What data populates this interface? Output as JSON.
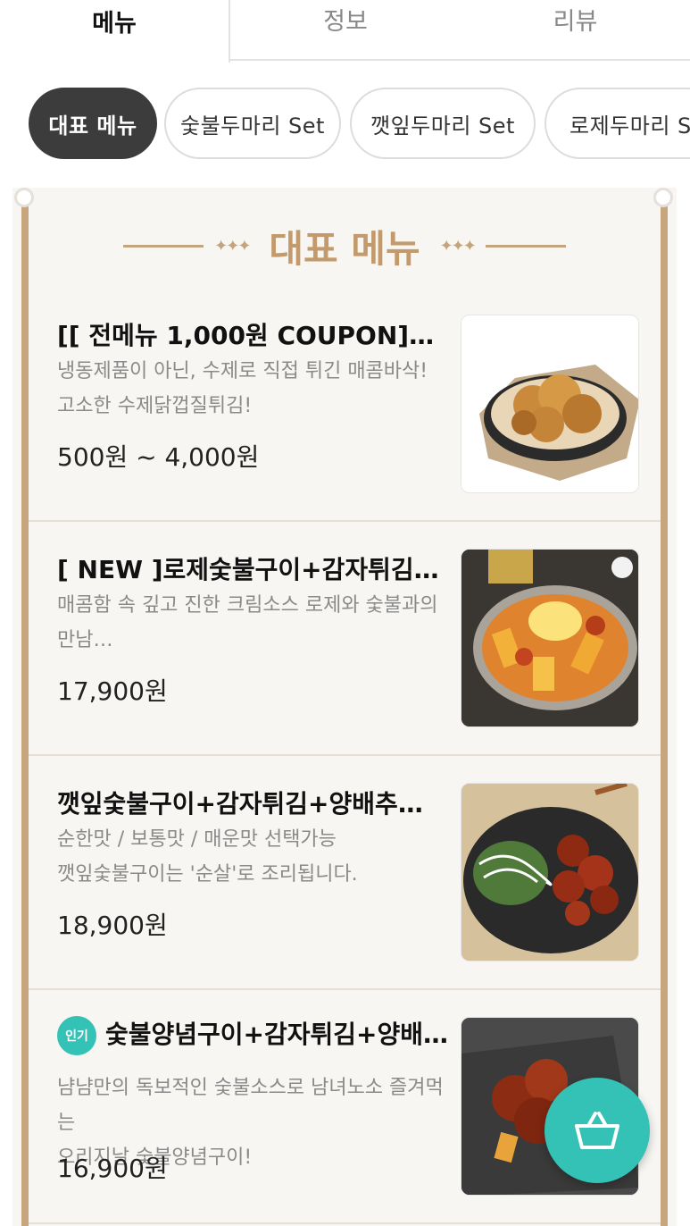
{
  "tabs": [
    {
      "label": "메뉴"
    },
    {
      "label": "정보"
    },
    {
      "label": "리뷰"
    }
  ],
  "categories": [
    {
      "label": "대표 메뉴",
      "active": true
    },
    {
      "label": "숯불두마리 Set"
    },
    {
      "label": "깻잎두마리 Set"
    },
    {
      "label": "로제두마리 Se"
    }
  ],
  "section": {
    "title": "대표 메뉴"
  },
  "items": [
    {
      "name": "[[ 전메뉴 1,000원 COUPON]]수…",
      "desc_line1": "냉동제품이 아닌, 수제로 직접 튀긴 매콤바삭!",
      "desc_line2": "고소한 수제닭껍질튀김!",
      "price": "500원 ~ 4,000원",
      "image": "fried-chicken-skin-photo"
    },
    {
      "name": "[ NEW ]로제숯불구이+감자튀김+…",
      "desc_line1": "매콤함 속 깊고 진한 크림소스 로제와 숯불과의",
      "desc_line2": "만남…",
      "price": "17,900원",
      "image": "rose-chicken-pan-photo"
    },
    {
      "name": "깻잎숯불구이+감자튀김+양배추샐…",
      "desc_line1": "순한맛 / 보통맛 / 매운맛 선택가능",
      "desc_line2": "깻잎숯불구이는 '순살'로 조리됩니다.",
      "price": "18,900원",
      "image": "perilla-chicken-plate-photo"
    },
    {
      "badge": "인기",
      "name": "숯불양념구이+감자튀김+양배…",
      "desc_line1": "냠냠만의 독보적인 숯불소스로 남녀노소 즐겨먹는",
      "desc_line2": "오리지날 숯불양념구이!",
      "price": "16,900원",
      "image": "glazed-chicken-slate-photo"
    }
  ],
  "cart": {
    "icon": "basket-icon"
  },
  "colors": {
    "accent": "#34c1b6",
    "gold": "#c29a6b",
    "chip_active": "#3c3c3c"
  }
}
